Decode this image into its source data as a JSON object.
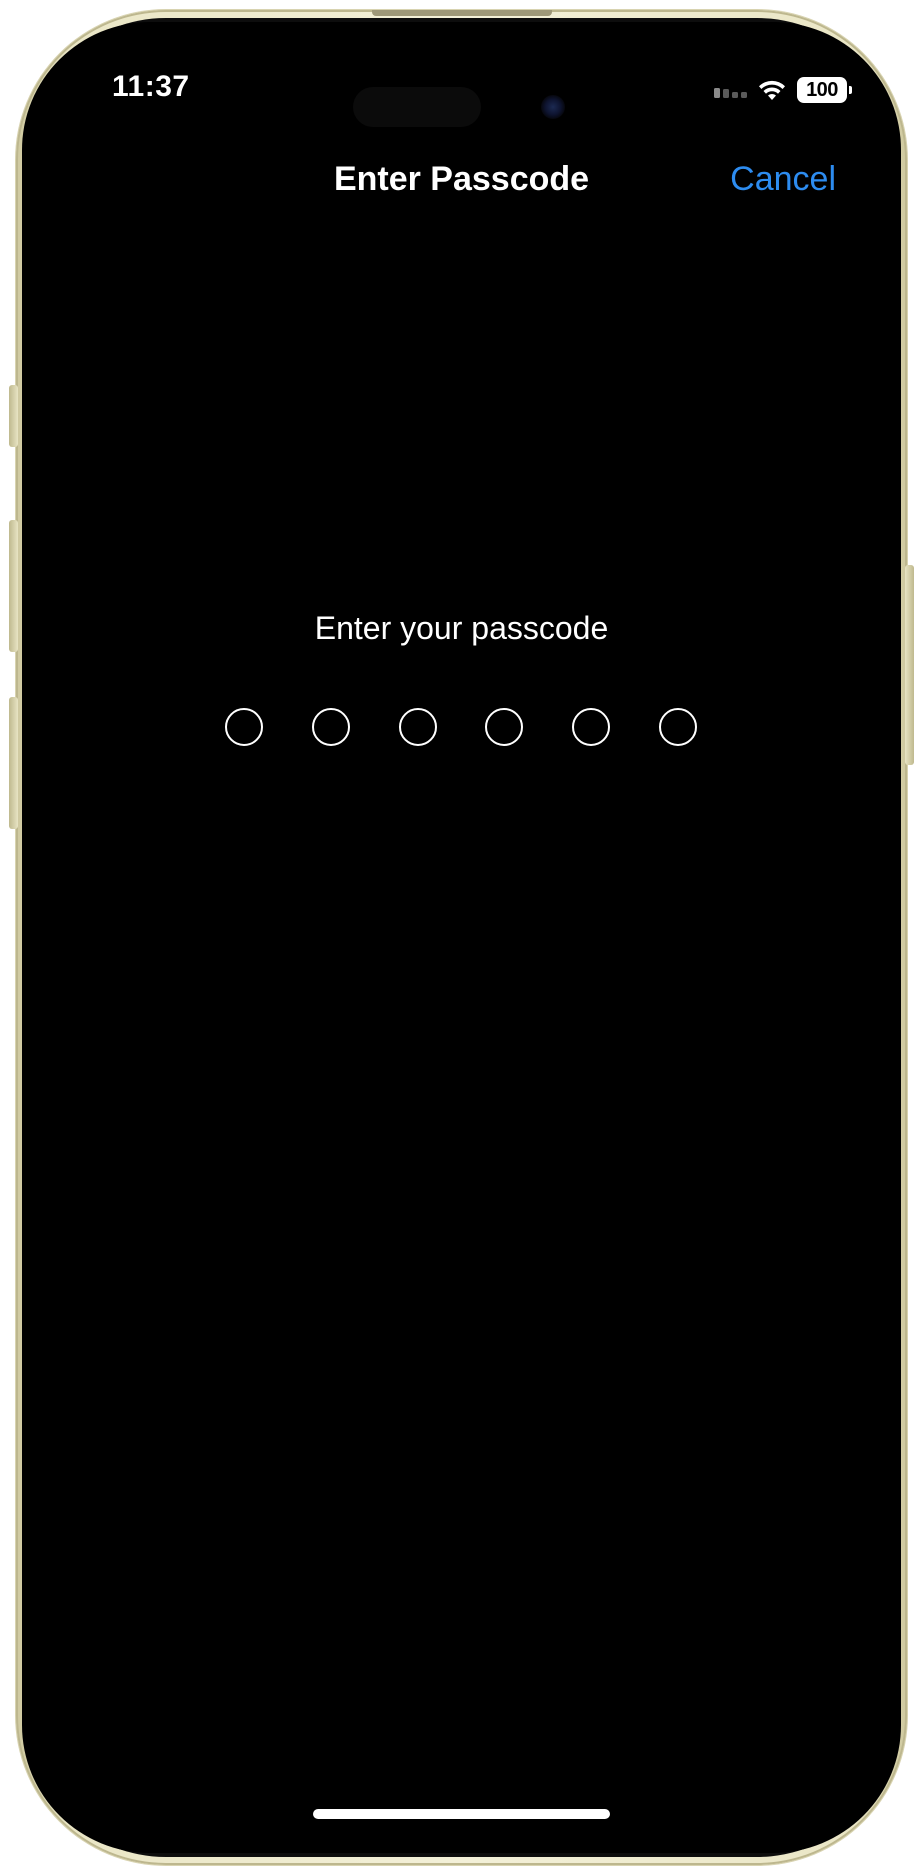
{
  "status_bar": {
    "time": "11:37",
    "battery": "100",
    "icons": [
      "signal-icon",
      "wifi-icon",
      "battery-icon"
    ]
  },
  "nav": {
    "title": "Enter Passcode",
    "cancel_label": "Cancel"
  },
  "passcode": {
    "prompt": "Enter your passcode",
    "length": 6,
    "entered": 0
  },
  "colors": {
    "accent": "#2d8cf0",
    "background": "#000000",
    "text": "#ffffff",
    "frame": "#eae6c6"
  }
}
